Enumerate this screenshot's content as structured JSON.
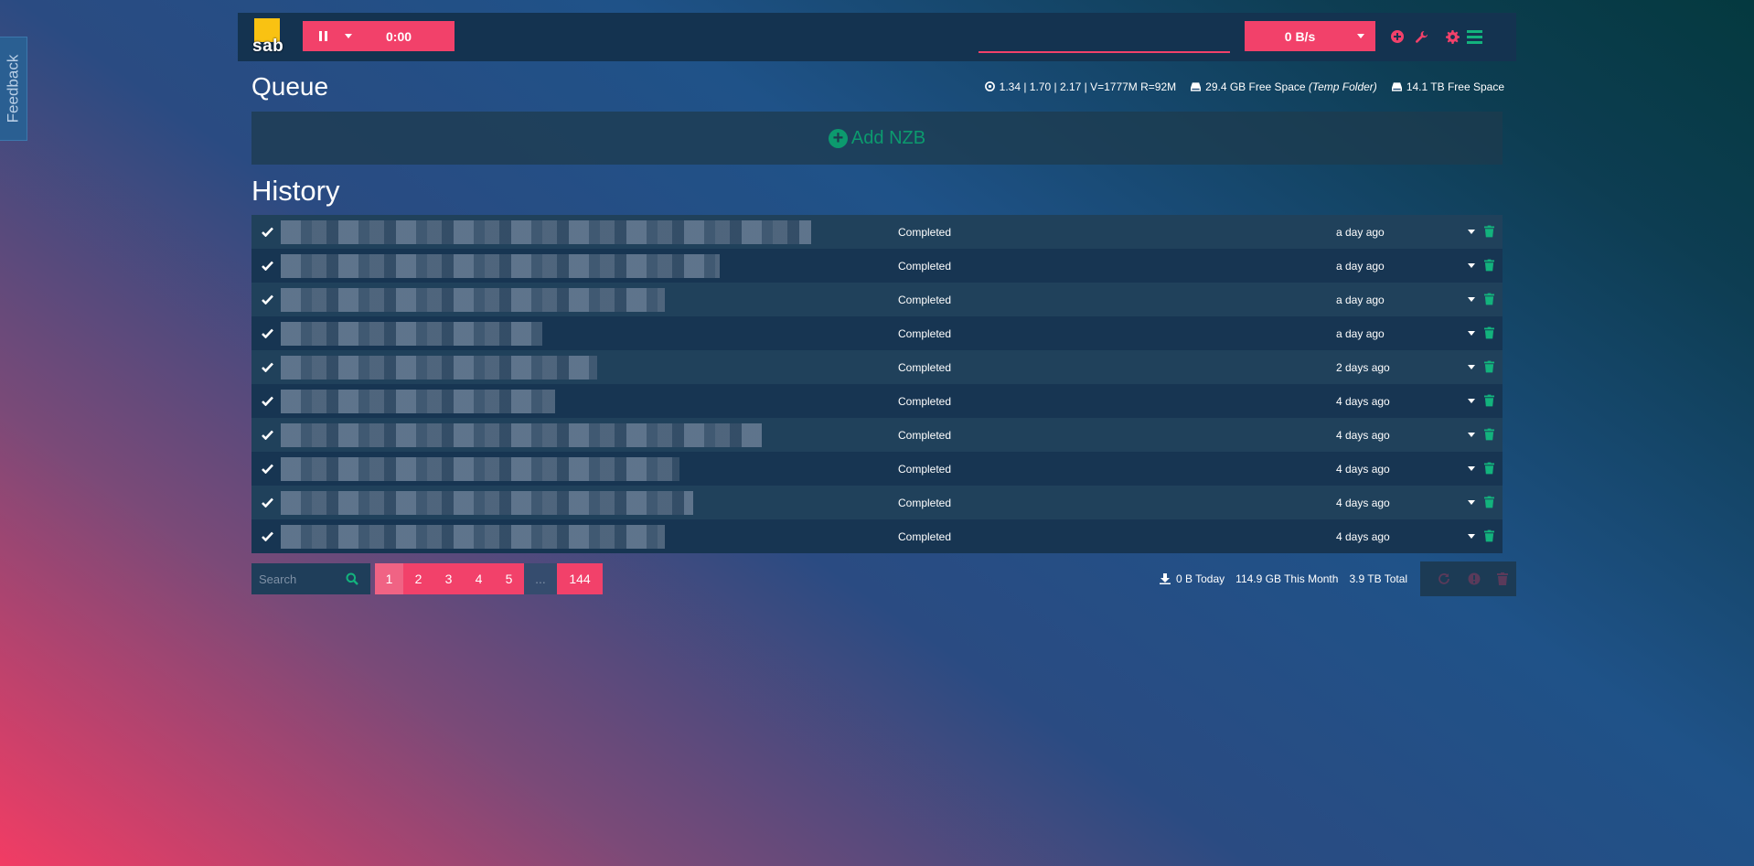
{
  "feedback": {
    "label": "Feedback"
  },
  "navbar": {
    "logo_text": "sab",
    "timer": "0:00",
    "speed": "0 B/s",
    "accent": "#f2416a",
    "icons": [
      "add-nzb-icon",
      "wrench-icon",
      "gear-icon",
      "menu-icon"
    ]
  },
  "queue": {
    "title": "Queue",
    "stats": {
      "load": "1.34 | 1.70 | 2.17 | V=1777M R=92M",
      "temp_space": "29.4 GB Free Space",
      "temp_space_note": "(Temp Folder)",
      "complete_space": "14.1 TB Free Space"
    },
    "add_nzb": "Add NZB"
  },
  "history": {
    "title": "History",
    "rows": [
      {
        "name": "redacted-download-1",
        "status": "Completed",
        "age": "a day ago"
      },
      {
        "name": "redacted-download-2",
        "status": "Completed",
        "age": "a day ago"
      },
      {
        "name": "redacted-download-3",
        "status": "Completed",
        "age": "a day ago"
      },
      {
        "name": "redacted-download-4",
        "status": "Completed",
        "age": "a day ago"
      },
      {
        "name": "redacted-download-5",
        "status": "Completed",
        "age": "2 days ago"
      },
      {
        "name": "redacted-download-6",
        "status": "Completed",
        "age": "4 days ago"
      },
      {
        "name": "redacted-download-7",
        "status": "Completed",
        "age": "4 days ago"
      },
      {
        "name": "redacted-download-8",
        "status": "Completed",
        "age": "4 days ago"
      },
      {
        "name": "redacted-download-9",
        "status": "Completed",
        "age": "4 days ago"
      },
      {
        "name": "redacted-download-10",
        "status": "Completed",
        "age": "4 days ago"
      }
    ]
  },
  "footer": {
    "search_placeholder": "Search",
    "pages": [
      "1",
      "2",
      "3",
      "4",
      "5",
      "...",
      "144"
    ],
    "today": "0 B Today",
    "month": "114.9 GB This Month",
    "total": "3.9 TB Total"
  }
}
